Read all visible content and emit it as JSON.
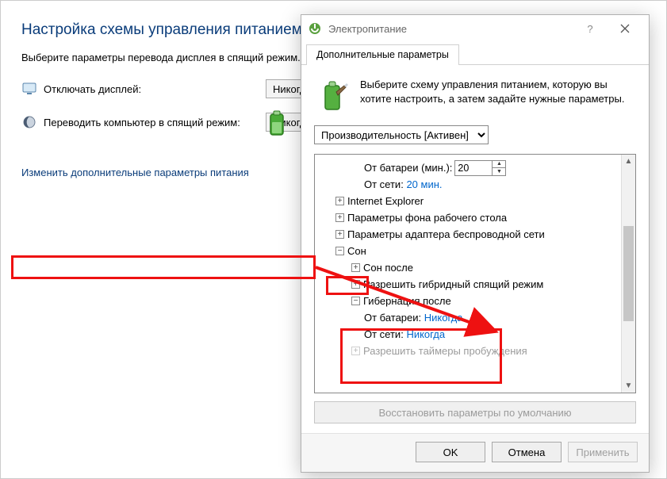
{
  "bg": {
    "title": "Настройка схемы управления питанием",
    "description": "Выберите параметры перевода дисплея в спящий режим.",
    "display_off_label": "Отключать дисплей:",
    "display_off_value": "Никогда",
    "sleep_label": "Переводить компьютер в спящий режим:",
    "sleep_value": "Никогда",
    "link": "Изменить дополнительные параметры питания"
  },
  "dialog": {
    "title": "Электропитание",
    "tab": "Дополнительные параметры",
    "intro": "Выберите схему управления питанием, которую вы хотите настроить, а затем задайте нужные параметры.",
    "plan": "Производительность [Активен]",
    "restore": "Восстановить параметры по умолчанию",
    "buttons": {
      "ok": "OK",
      "cancel": "Отмена",
      "apply": "Применить"
    }
  },
  "tree": {
    "battery_min_label": "От батареи (мин.):",
    "battery_min_value": "20",
    "ac_label": "От сети:",
    "ac_value": "20 мин.",
    "ie": "Internet Explorer",
    "desktop_bg": "Параметры фона рабочего стола",
    "wifi": "Параметры адаптера беспроводной сети",
    "sleep": "Сон",
    "sleep_after": "Сон после",
    "hybrid": "Разрешить гибридный спящий режим",
    "hibernate": "Гибернация после",
    "on_battery_label": "От батареи:",
    "on_battery_value": "Никогда",
    "on_ac_label": "От сети:",
    "on_ac_value": "Никогда",
    "wake_timers": "Разрешить таймеры пробуждения"
  }
}
